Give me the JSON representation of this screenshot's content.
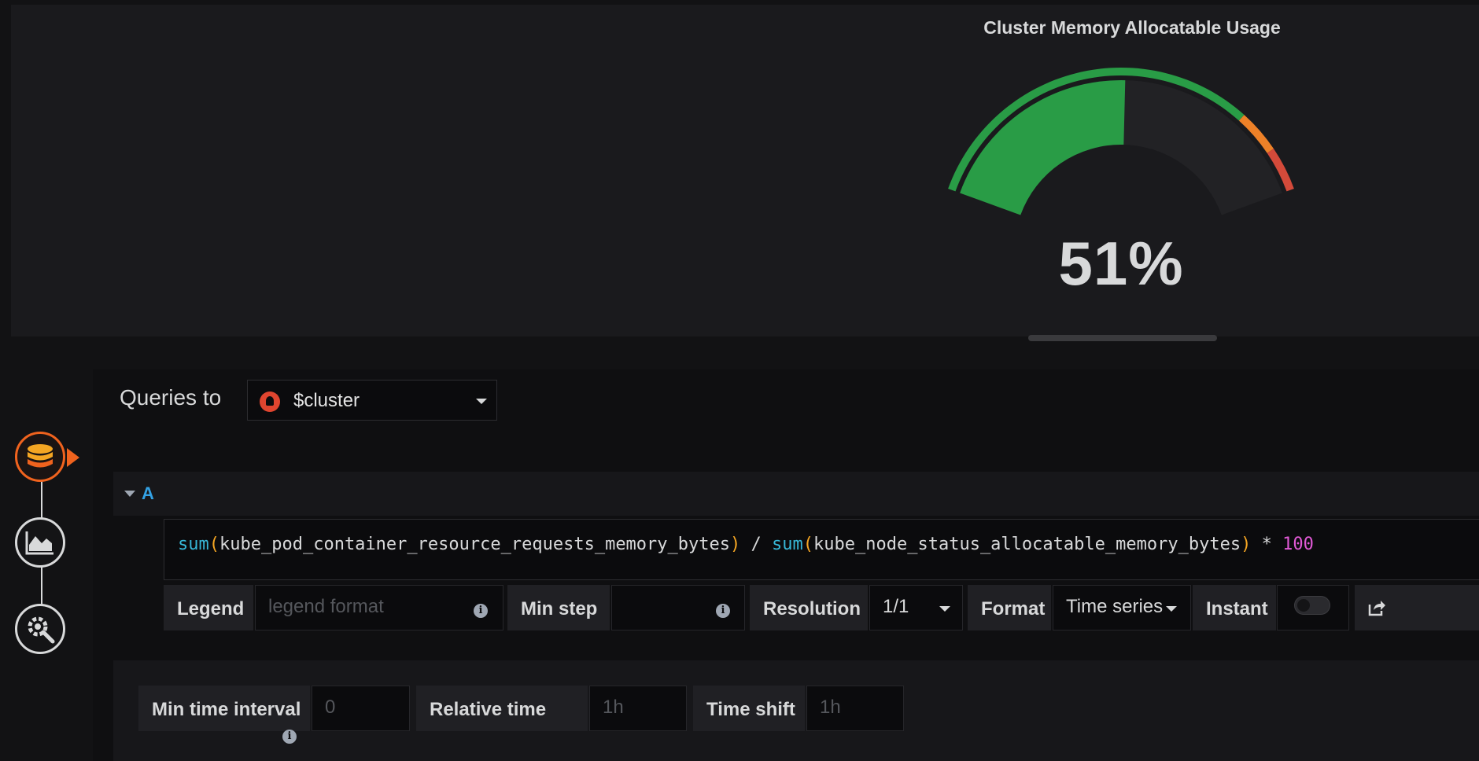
{
  "panel": {
    "title": "Cluster Memory Allocatable Usage",
    "gauge": {
      "value": 51,
      "display": "51%",
      "min": 0,
      "max": 100,
      "thresholds": [
        {
          "from": 0,
          "to": 80,
          "color": "#299c46"
        },
        {
          "from": 80,
          "to": 90,
          "color": "#ed8128"
        },
        {
          "from": 90,
          "to": 100,
          "color": "#d44a3a"
        }
      ],
      "fill_color": "#299c46",
      "track_color": "#222225"
    }
  },
  "editor": {
    "queries_to_label": "Queries to",
    "datasource": {
      "name": "$cluster",
      "icon": "prometheus-icon"
    },
    "sidebar": [
      {
        "name": "queries-tab",
        "icon": "database-icon",
        "active": true
      },
      {
        "name": "visualization-tab",
        "icon": "area-chart-icon",
        "active": false
      },
      {
        "name": "general-tab",
        "icon": "gear-wrench-icon",
        "active": false
      }
    ],
    "query": {
      "ref_id": "A",
      "expr_tokens": {
        "fn1": "sum",
        "open1": "(",
        "metric1": "kube_pod_container_resource_requests_memory_bytes",
        "close1": ")",
        "op1": " / ",
        "fn2": "sum",
        "open2": "(",
        "metric2": "kube_node_status_allocatable_memory_bytes",
        "close2": ")",
        "op2": " * ",
        "num": "100"
      },
      "legend_label": "Legend",
      "legend_placeholder": "legend format",
      "min_step_label": "Min step",
      "min_step_value": "",
      "resolution_label": "Resolution",
      "resolution_value": "1/1",
      "format_label": "Format",
      "format_value": "Time series",
      "instant_label": "Instant",
      "instant_on": false
    },
    "options": {
      "min_interval_label": "Min time interval",
      "min_interval_placeholder": "0",
      "relative_time_label": "Relative time",
      "relative_time_placeholder": "1h",
      "time_shift_label": "Time shift",
      "time_shift_placeholder": "1h"
    }
  }
}
